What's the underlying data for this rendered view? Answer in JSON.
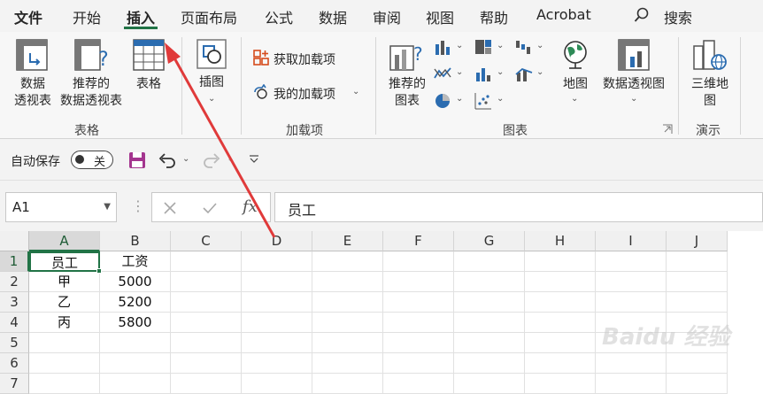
{
  "tabs": [
    {
      "label": "文件",
      "active": false,
      "bold": true
    },
    {
      "label": "开始",
      "active": false
    },
    {
      "label": "插入",
      "active": true
    },
    {
      "label": "页面布局",
      "active": false
    },
    {
      "label": "公式",
      "active": false
    },
    {
      "label": "数据",
      "active": false
    },
    {
      "label": "审阅",
      "active": false
    },
    {
      "label": "视图",
      "active": false
    },
    {
      "label": "帮助",
      "active": false
    },
    {
      "label": "Acrobat",
      "active": false
    }
  ],
  "search_label": "搜索",
  "ribbon": {
    "pivot_table_line1": "数据",
    "pivot_table_line2": "透视表",
    "recommended_pivot_line1": "推荐的",
    "recommended_pivot_line2": "数据透视表",
    "table_label": "表格",
    "tables_group": "表格",
    "illustrations_label": "插图",
    "get_addins": "获取加载项",
    "my_addins": "我的加载项",
    "addins_group": "加载项",
    "recommended_charts_line1": "推荐的",
    "recommended_charts_line2": "图表",
    "charts_group": "图表",
    "map_label": "地图",
    "pivot_chart_label": "数据透视图",
    "threed_map_line1": "三维地",
    "threed_map_line2": "图",
    "tours_group": "演示"
  },
  "qat": {
    "autosave_label": "自动保存",
    "toggle_label": "关"
  },
  "formula_bar": {
    "name_box": "A1",
    "fx": "fx",
    "content": "员工"
  },
  "grid": {
    "columns": [
      "A",
      "B",
      "C",
      "D",
      "E",
      "F",
      "G",
      "H",
      "I",
      "J"
    ],
    "rows": [
      "1",
      "2",
      "3",
      "4",
      "5",
      "6",
      "7"
    ],
    "cells": [
      [
        "员工",
        "工资"
      ],
      [
        "甲",
        "5000"
      ],
      [
        "乙",
        "5200"
      ],
      [
        "丙",
        "5800"
      ]
    ]
  },
  "colors": {
    "accent": "#217346",
    "arrow": "#e03a3a"
  }
}
